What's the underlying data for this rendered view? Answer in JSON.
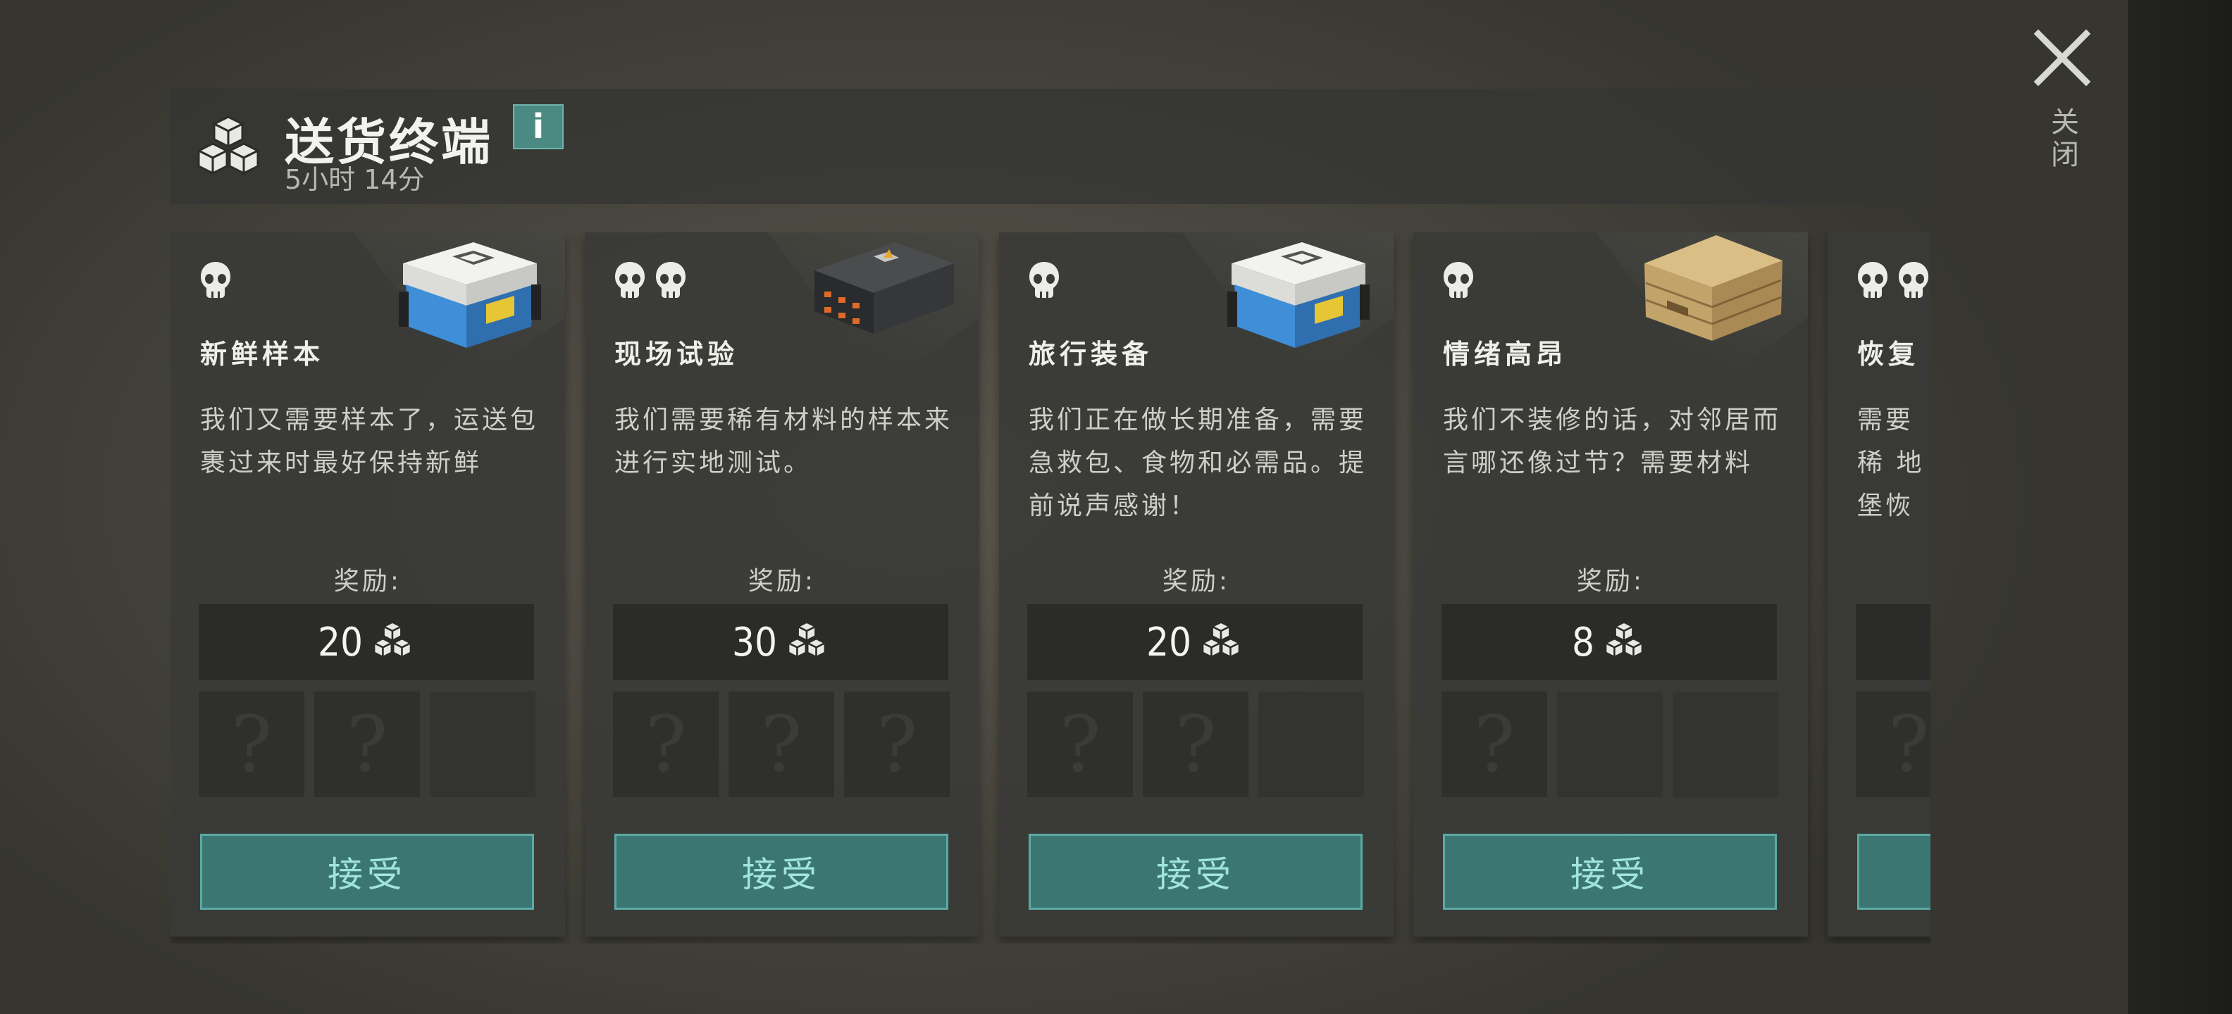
{
  "header": {
    "title": "送货终端",
    "info_label": "i",
    "timer": "5小时 14分",
    "icon": "crates-icon"
  },
  "close": {
    "label": "关闭",
    "icon": "close-x-icon"
  },
  "reward_label": "奖励:",
  "unknown_slot": "?",
  "accept_label": "接受",
  "colors": {
    "accent": "#3c7672",
    "accent_border": "#5aaaa4",
    "accent_text": "#9fe4de",
    "card_bg": "#393b37"
  },
  "cards": [
    {
      "name": "新鲜样本",
      "skulls": 1,
      "item": "blue-cooler-box",
      "description": "我们又需要样本了，运送包裹过来时最好保持新鲜",
      "reward": "20",
      "slots": [
        "?",
        "?",
        ""
      ]
    },
    {
      "name": "现场试验",
      "skulls": 2,
      "item": "black-military-case",
      "description": "我们需要稀有材料的样本来进行实地测试。",
      "reward": "30",
      "slots": [
        "?",
        "?",
        "?"
      ]
    },
    {
      "name": "旅行装备",
      "skulls": 1,
      "item": "blue-cooler-box",
      "description": "我们正在做长期准备，需要急救包、食物和必需品。提前说声感谢！",
      "reward": "20",
      "slots": [
        "?",
        "?",
        ""
      ]
    },
    {
      "name": "情绪高昂",
      "skulls": 1,
      "item": "wooden-crate",
      "description": "我们不装修的话，对邻居而言哪还像过节？需要材料",
      "reward": "8",
      "slots": [
        "?",
        "",
        ""
      ]
    },
    {
      "name": "恢复",
      "skulls": 2,
      "item": "none",
      "description": "需要稀 地堡恢 抓紧时",
      "reward": "",
      "slots": [
        "?",
        "",
        ""
      ]
    }
  ]
}
